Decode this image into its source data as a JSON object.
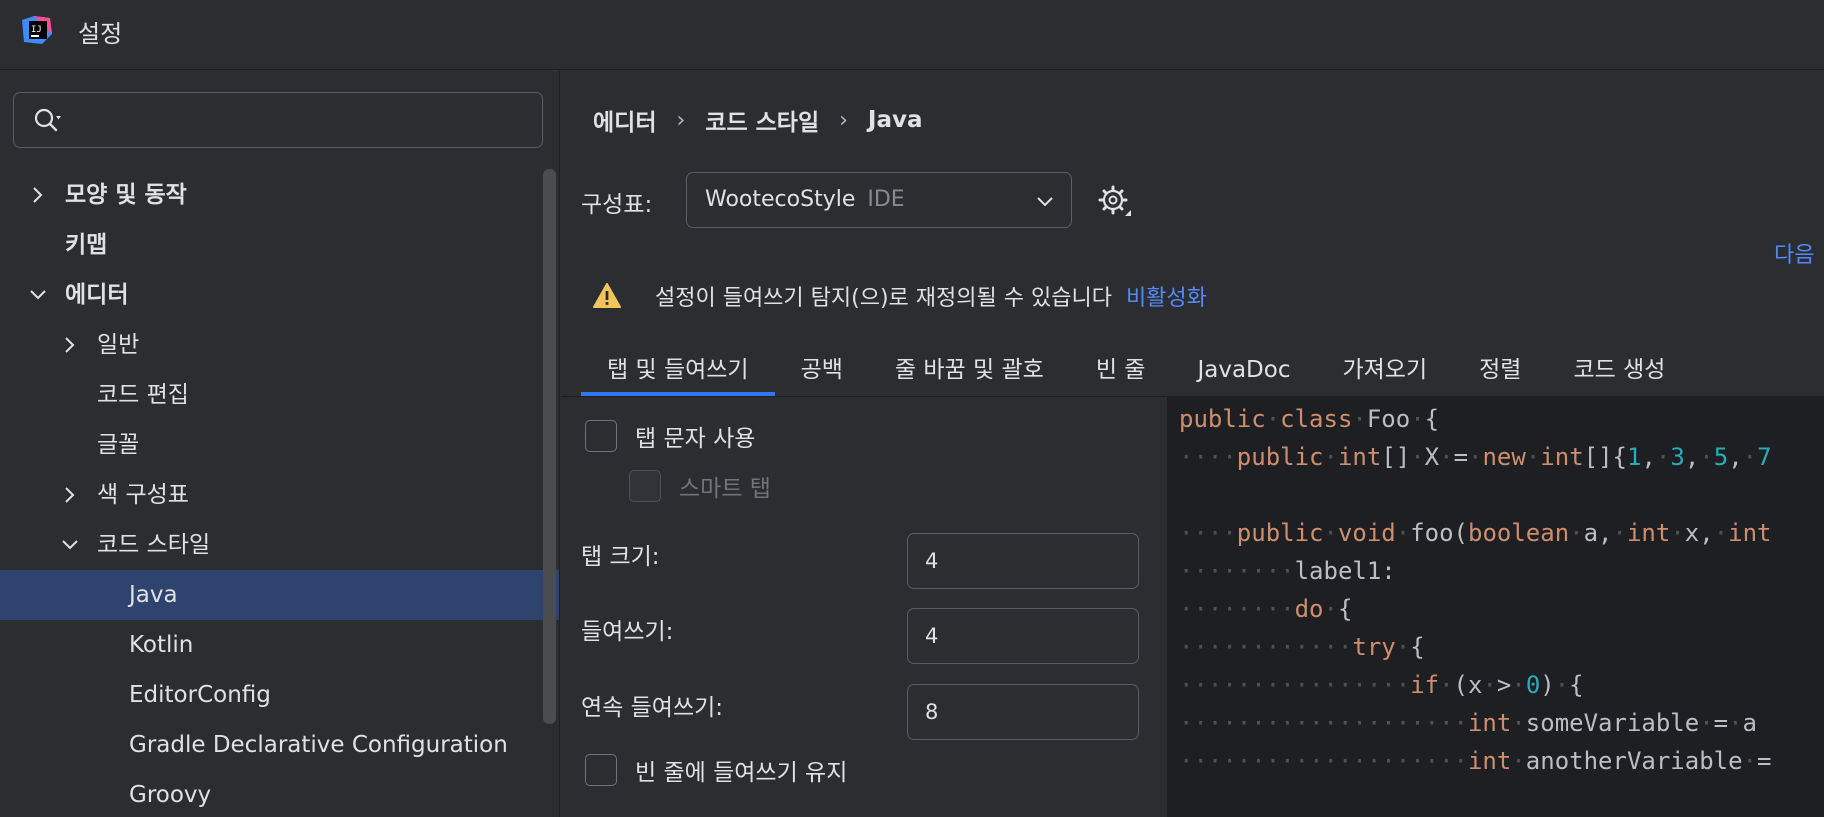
{
  "window": {
    "title": "설정"
  },
  "search": {
    "placeholder": "",
    "value": ""
  },
  "tree": [
    {
      "label": "모양 및 동작",
      "level": 0,
      "chevron": "right",
      "bold": true
    },
    {
      "label": "키맵",
      "level": 0,
      "chevron": "none",
      "bold": true
    },
    {
      "label": "에디터",
      "level": 0,
      "chevron": "down",
      "bold": true
    },
    {
      "label": "일반",
      "level": 1,
      "chevron": "right",
      "bold": false
    },
    {
      "label": "코드 편집",
      "level": 1,
      "chevron": "none",
      "bold": false
    },
    {
      "label": "글꼴",
      "level": 1,
      "chevron": "none",
      "bold": false
    },
    {
      "label": "색 구성표",
      "level": 1,
      "chevron": "right",
      "bold": false
    },
    {
      "label": "코드 스타일",
      "level": 1,
      "chevron": "down",
      "bold": false
    },
    {
      "label": "Java",
      "level": 2,
      "chevron": "none",
      "bold": false,
      "selected": true
    },
    {
      "label": "Kotlin",
      "level": 2,
      "chevron": "none",
      "bold": false
    },
    {
      "label": "EditorConfig",
      "level": 2,
      "chevron": "none",
      "bold": false
    },
    {
      "label": "Gradle Declarative Configuration",
      "level": 2,
      "chevron": "none",
      "bold": false
    },
    {
      "label": "Groovy",
      "level": 2,
      "chevron": "none",
      "bold": false
    }
  ],
  "breadcrumb": [
    "에디터",
    "코드 스타일",
    "Java"
  ],
  "scheme": {
    "label": "구성표:",
    "name": "WootecoStyle",
    "tag": "IDE"
  },
  "next_link": "다음",
  "warning": {
    "text": "설정이 들여쓰기 탐지(으)로 재정의될 수 있습니다",
    "link": "비활성화"
  },
  "tabs": [
    "탭 및 들여쓰기",
    "공백",
    "줄 바꿈 및 괄호",
    "빈 줄",
    "JavaDoc",
    "가져오기",
    "정렬",
    "코드 생성"
  ],
  "active_tab": 0,
  "options": {
    "use_tab": {
      "label": "탭 문자 사용",
      "checked": false
    },
    "smart_tab": {
      "label": "스마트 탭",
      "checked": false,
      "disabled": true
    },
    "tab_size": {
      "label": "탭 크기:",
      "value": "4"
    },
    "indent": {
      "label": "들여쓰기:",
      "value": "4"
    },
    "continuation_indent": {
      "label": "연속 들여쓰기:",
      "value": "8"
    },
    "keep_indents_empty": {
      "label": "빈 줄에 들여쓰기 유지",
      "checked": false
    }
  },
  "code_preview": [
    [
      [
        "kw",
        "public"
      ],
      [
        "dots",
        "·"
      ],
      [
        "kw",
        "class"
      ],
      [
        "dots",
        "·"
      ],
      [
        "",
        "Foo"
      ],
      [
        "dots",
        "·"
      ],
      [
        "",
        "{"
      ]
    ],
    [
      [
        "dots",
        "····"
      ],
      [
        "kw",
        "public"
      ],
      [
        "dots",
        "·"
      ],
      [
        "kw",
        "int"
      ],
      [
        "",
        "[]"
      ],
      [
        "dots",
        "·"
      ],
      [
        "",
        "X"
      ],
      [
        "dots",
        "·"
      ],
      [
        "",
        "="
      ],
      [
        "dots",
        "·"
      ],
      [
        "kw",
        "new"
      ],
      [
        "dots",
        "·"
      ],
      [
        "kw",
        "int"
      ],
      [
        "",
        "[]{"
      ],
      [
        "num",
        "1"
      ],
      [
        "",
        ","
      ],
      [
        "dots",
        "·"
      ],
      [
        "num",
        "3"
      ],
      [
        "",
        ","
      ],
      [
        "dots",
        "·"
      ],
      [
        "num",
        "5"
      ],
      [
        "",
        ","
      ],
      [
        "dots",
        "·"
      ],
      [
        "num",
        "7"
      ]
    ],
    [],
    [
      [
        "dots",
        "····"
      ],
      [
        "kw",
        "public"
      ],
      [
        "dots",
        "·"
      ],
      [
        "kw",
        "void"
      ],
      [
        "dots",
        "·"
      ],
      [
        "",
        "foo("
      ],
      [
        "kw",
        "boolean"
      ],
      [
        "dots",
        "·"
      ],
      [
        "",
        "a,"
      ],
      [
        "dots",
        "·"
      ],
      [
        "kw",
        "int"
      ],
      [
        "dots",
        "·"
      ],
      [
        "",
        "x,"
      ],
      [
        "dots",
        "·"
      ],
      [
        "kw",
        "int"
      ]
    ],
    [
      [
        "dots",
        "········"
      ],
      [
        "",
        "label1:"
      ]
    ],
    [
      [
        "dots",
        "········"
      ],
      [
        "kw",
        "do"
      ],
      [
        "dots",
        "·"
      ],
      [
        "",
        "{"
      ]
    ],
    [
      [
        "dots",
        "············"
      ],
      [
        "kw",
        "try"
      ],
      [
        "dots",
        "·"
      ],
      [
        "",
        "{"
      ]
    ],
    [
      [
        "dots",
        "················"
      ],
      [
        "kw",
        "if"
      ],
      [
        "dots",
        "·"
      ],
      [
        "",
        "(x"
      ],
      [
        "dots",
        "·"
      ],
      [
        "",
        ">"
      ],
      [
        "dots",
        "·"
      ],
      [
        "num",
        "0"
      ],
      [
        "",
        ")"
      ],
      [
        "dots",
        "·"
      ],
      [
        "",
        "{"
      ]
    ],
    [
      [
        "dots",
        "····················"
      ],
      [
        "kw",
        "int"
      ],
      [
        "dots",
        "·"
      ],
      [
        "",
        "someVariable"
      ],
      [
        "dots",
        "·"
      ],
      [
        "",
        "="
      ],
      [
        "dots",
        "·"
      ],
      [
        "",
        "a"
      ]
    ],
    [
      [
        "dots",
        "····················"
      ],
      [
        "kw",
        "int"
      ],
      [
        "dots",
        "·"
      ],
      [
        "",
        "anotherVariable"
      ],
      [
        "dots",
        "·"
      ],
      [
        "",
        "="
      ]
    ]
  ]
}
